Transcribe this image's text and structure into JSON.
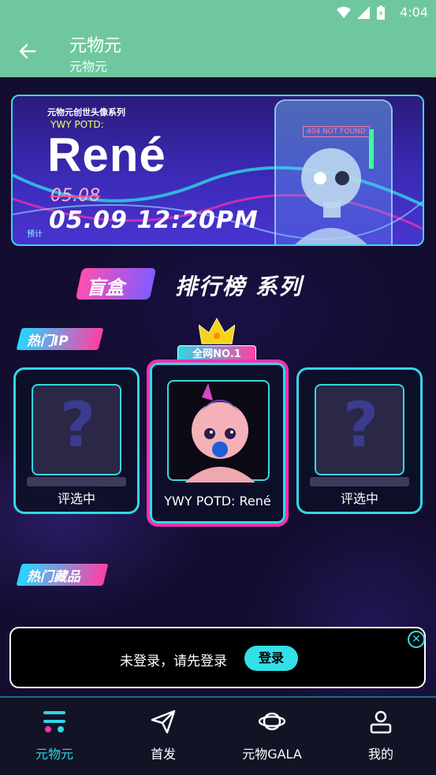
{
  "status_bar": {
    "time": "4:04"
  },
  "app_bar": {
    "title": "元物元",
    "subtitle": "元物元"
  },
  "banner": {
    "series_title": "元物元创世头像系列",
    "potd_label": "YWY POTD:",
    "name": "René",
    "old_date": "05.08",
    "prefix": "预计",
    "new_date": "05.09 12:20PM",
    "error_text": "404 NOT FOUND"
  },
  "ranking": {
    "blind_box": "盲盒",
    "series": "排行榜 系列"
  },
  "tags": {
    "hot_ip": "热门IP",
    "hot_collection": "热门藏品"
  },
  "badge": {
    "no1": "全网NO.1"
  },
  "cards": [
    {
      "label": "评选中"
    },
    {
      "label": "YWY POTD: René"
    },
    {
      "label": "评选中"
    }
  ],
  "login_bar": {
    "message": "未登录，请先登录",
    "button": "登录"
  },
  "tabs": [
    {
      "label": "元物元",
      "icon": "menu-icon"
    },
    {
      "label": "首发",
      "icon": "send-icon"
    },
    {
      "label": "元物GALA",
      "icon": "planet-icon"
    },
    {
      "label": "我的",
      "icon": "profile-icon"
    }
  ],
  "colors": {
    "accent": "#2fd6e6",
    "pink": "#ff2fb2",
    "appbar": "#6fc7a0"
  }
}
